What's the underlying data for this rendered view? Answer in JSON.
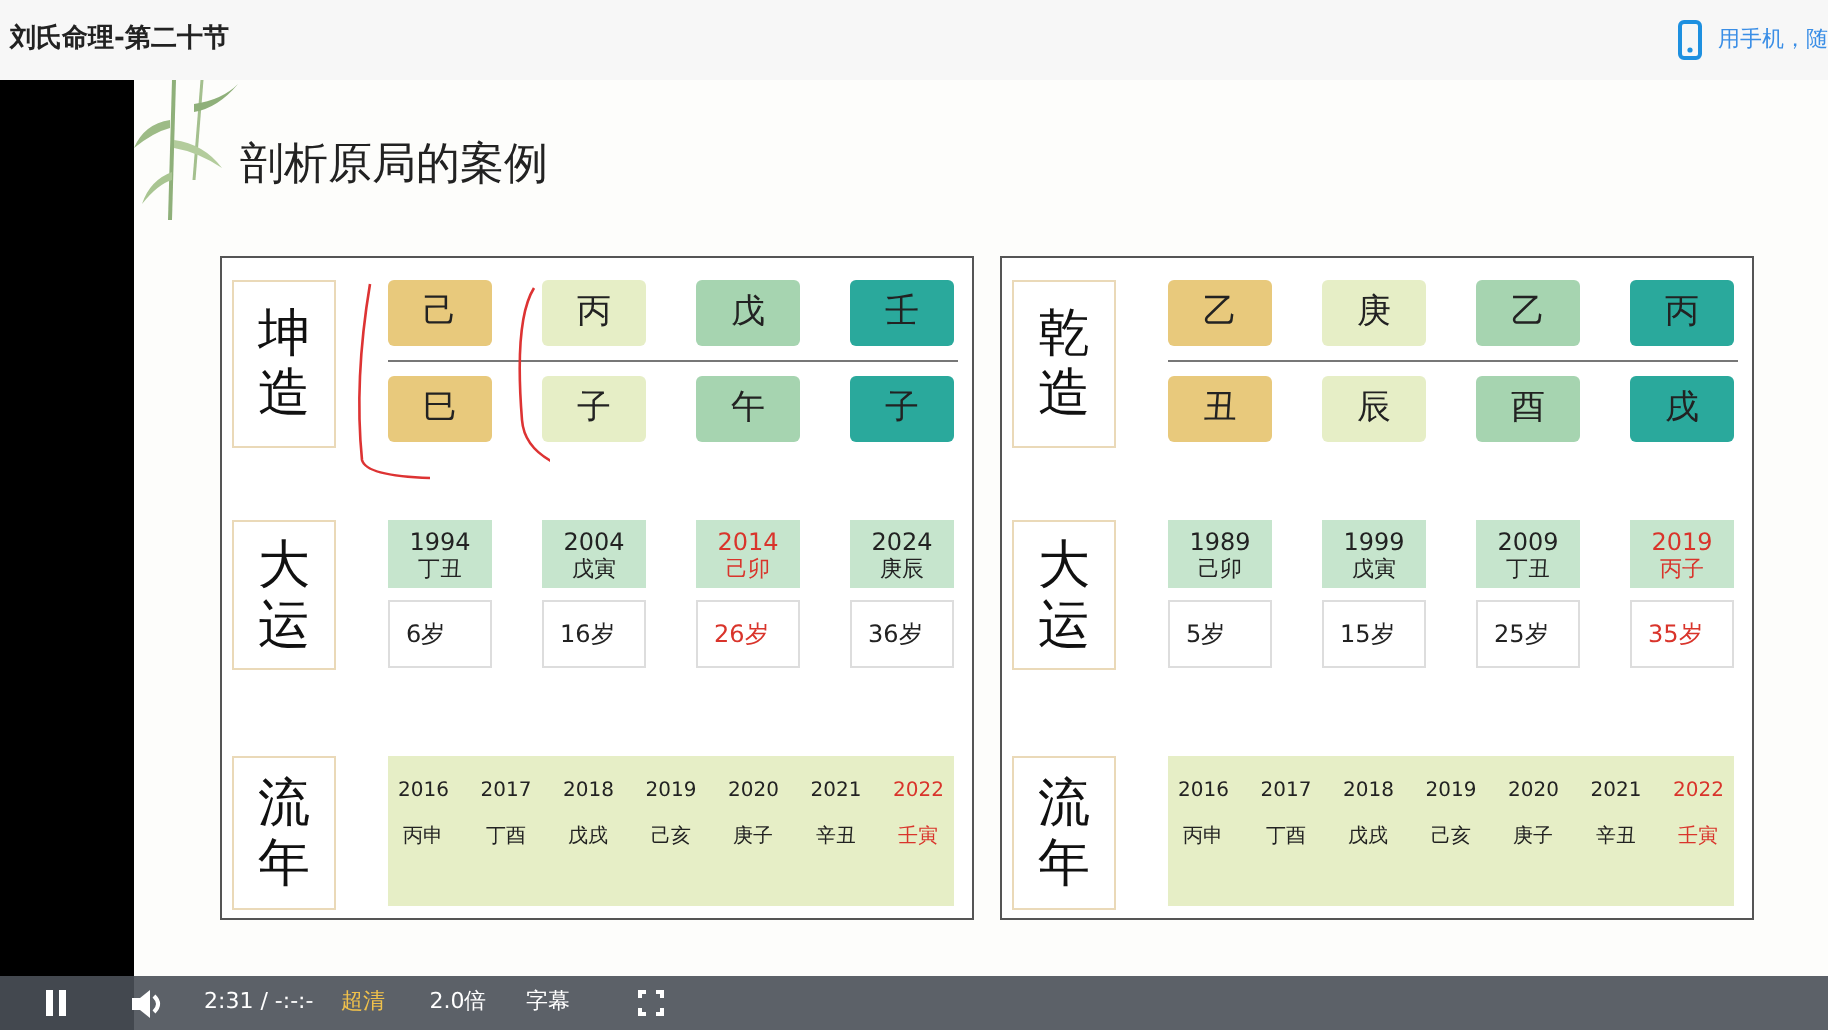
{
  "header": {
    "title": "刘氏命理-第二十节",
    "mobile_link": "用手机，随"
  },
  "slide": {
    "title": "剖析原局的案例",
    "charts": [
      {
        "label": "坤造",
        "annotated": true,
        "pillars": [
          {
            "stem": "己",
            "branch": "巳",
            "color": "#e8c97c"
          },
          {
            "stem": "丙",
            "branch": "子",
            "color": "#e6eec6"
          },
          {
            "stem": "戊",
            "branch": "午",
            "color": "#a6d4b0"
          },
          {
            "stem": "壬",
            "branch": "子",
            "color": "#2aa99c"
          }
        ],
        "dayun_label": "大运",
        "dayun": [
          {
            "year": "1994",
            "ganzhi": "丁丑",
            "age": "6岁",
            "highlight": false
          },
          {
            "year": "2004",
            "ganzhi": "戊寅",
            "age": "16岁",
            "highlight": false
          },
          {
            "year": "2014",
            "ganzhi": "己卯",
            "age": "26岁",
            "highlight": true
          },
          {
            "year": "2024",
            "ganzhi": "庚辰",
            "age": "36岁",
            "highlight": false
          }
        ],
        "liunian_label": "流年",
        "liunian": [
          {
            "year": "2016",
            "ganzhi": "丙申",
            "highlight": false
          },
          {
            "year": "2017",
            "ganzhi": "丁酉",
            "highlight": false
          },
          {
            "year": "2018",
            "ganzhi": "戊戌",
            "highlight": false
          },
          {
            "year": "2019",
            "ganzhi": "己亥",
            "highlight": false
          },
          {
            "year": "2020",
            "ganzhi": "庚子",
            "highlight": false
          },
          {
            "year": "2021",
            "ganzhi": "辛丑",
            "highlight": false
          },
          {
            "year": "2022",
            "ganzhi": "壬寅",
            "highlight": true
          }
        ]
      },
      {
        "label": "乾造",
        "annotated": false,
        "pillars": [
          {
            "stem": "乙",
            "branch": "丑",
            "color": "#e8c97c"
          },
          {
            "stem": "庚",
            "branch": "辰",
            "color": "#e6eec6"
          },
          {
            "stem": "乙",
            "branch": "酉",
            "color": "#a6d4b0"
          },
          {
            "stem": "丙",
            "branch": "戌",
            "color": "#2aa99c"
          }
        ],
        "dayun_label": "大运",
        "dayun": [
          {
            "year": "1989",
            "ganzhi": "己卯",
            "age": "5岁",
            "highlight": false
          },
          {
            "year": "1999",
            "ganzhi": "戊寅",
            "age": "15岁",
            "highlight": false
          },
          {
            "year": "2009",
            "ganzhi": "丁丑",
            "age": "25岁",
            "highlight": false
          },
          {
            "year": "2019",
            "ganzhi": "丙子",
            "age": "35岁",
            "highlight": true
          }
        ],
        "liunian_label": "流年",
        "liunian": [
          {
            "year": "2016",
            "ganzhi": "丙申",
            "highlight": false
          },
          {
            "year": "2017",
            "ganzhi": "丁酉",
            "highlight": false
          },
          {
            "year": "2018",
            "ganzhi": "戊戌",
            "highlight": false
          },
          {
            "year": "2019",
            "ganzhi": "己亥",
            "highlight": false
          },
          {
            "year": "2020",
            "ganzhi": "庚子",
            "highlight": false
          },
          {
            "year": "2021",
            "ganzhi": "辛丑",
            "highlight": false
          },
          {
            "year": "2022",
            "ganzhi": "壬寅",
            "highlight": true
          }
        ]
      }
    ]
  },
  "player": {
    "playing": true,
    "time": "2:31 / -:-:-",
    "quality": "超清",
    "speed": "2.0倍",
    "subtitles": "字幕"
  }
}
